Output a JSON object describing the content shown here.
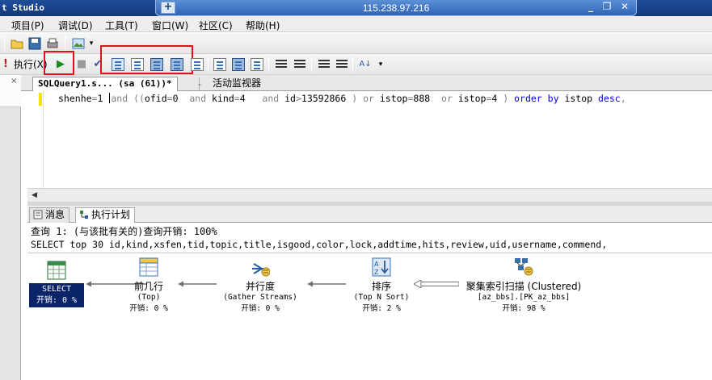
{
  "window": {
    "title": "t Studio",
    "remote_host": "115.238.97.216",
    "pin_glyph": "+",
    "minimize_glyph": "_",
    "restore_glyph": "❐",
    "close_glyph": "✕"
  },
  "menu": [
    "项目(P)",
    "调试(D)",
    "工具(T)",
    "窗口(W)",
    "社区(C)",
    "帮助(H)"
  ],
  "toolbar": {
    "execute_label": "执行(X)",
    "execute_icon_glyph": "!",
    "run_glyph": "▶",
    "stop_glyph": "■",
    "check_glyph": "✔",
    "az_glyph": "A↓"
  },
  "document_tabs": {
    "query_tab": "SQLQuery1.s...  (sa (61))*",
    "close_glyph": "×",
    "activity_tab": "活动监视器"
  },
  "editor": {
    "tokens": [
      {
        "t": "shenhe",
        "c": "id"
      },
      {
        "t": "=",
        "c": "op"
      },
      {
        "t": "1 ",
        "c": "num"
      },
      {
        "t": "CARET",
        "c": "caret"
      },
      {
        "t": "and",
        "c": "op"
      },
      {
        "t": " ",
        "c": "id"
      },
      {
        "t": "((",
        "c": "op"
      },
      {
        "t": "ofid",
        "c": "id"
      },
      {
        "t": "=",
        "c": "op"
      },
      {
        "t": "0  ",
        "c": "num"
      },
      {
        "t": "and",
        "c": "op"
      },
      {
        "t": " kind",
        "c": "id"
      },
      {
        "t": "=",
        "c": "op"
      },
      {
        "t": "4   ",
        "c": "num"
      },
      {
        "t": "and",
        "c": "op"
      },
      {
        "t": " id",
        "c": "id"
      },
      {
        "t": ">",
        "c": "op"
      },
      {
        "t": "13592866 ",
        "c": "num"
      },
      {
        "t": ")",
        "c": "op"
      },
      {
        "t": " ",
        "c": "id"
      },
      {
        "t": "or",
        "c": "op"
      },
      {
        "t": " istop",
        "c": "id"
      },
      {
        "t": "=",
        "c": "op"
      },
      {
        "t": "888  ",
        "c": "num"
      },
      {
        "t": "or",
        "c": "op"
      },
      {
        "t": " istop",
        "c": "id"
      },
      {
        "t": "=",
        "c": "op"
      },
      {
        "t": "4 ",
        "c": "num"
      },
      {
        "t": ")",
        "c": "op"
      },
      {
        "t": " order by ",
        "c": "kw"
      },
      {
        "t": "istop ",
        "c": "id"
      },
      {
        "t": "desc",
        "c": "kw"
      },
      {
        "t": ",",
        "c": "op"
      }
    ]
  },
  "results_tabs": {
    "messages": "消息",
    "execution_plan": "执行计划"
  },
  "results": {
    "query_header": "查询 1: (与该批有关的)查询开销: 100%",
    "query_text": "SELECT top 30 id,kind,xsfen,tid,topic,title,isgood,color,lock,addtime,hits,review,uid,username,commend,"
  },
  "plan_nodes": [
    {
      "id": "select",
      "title": "SELECT",
      "cost": "开销: 0 %"
    },
    {
      "id": "top",
      "title": "前几行",
      "sub": "(Top)",
      "cost": "开销: 0 %"
    },
    {
      "id": "parallel",
      "title": "并行度",
      "sub": "(Gather Streams)",
      "cost": "开销: 0 %"
    },
    {
      "id": "sort",
      "title": "排序",
      "sub": "(Top N Sort)",
      "cost": "开销: 2 %"
    },
    {
      "id": "scan",
      "title": "聚集索引扫描 (Clustered)",
      "sub": "[az_bbs].[PK_az_bbs]",
      "cost": "开销: 98 %"
    }
  ],
  "colors": {
    "titlebar": "#123a7a",
    "highlight_box": "#e0101a",
    "selected_node": "#0a246a",
    "keyword": "#0000ff"
  }
}
